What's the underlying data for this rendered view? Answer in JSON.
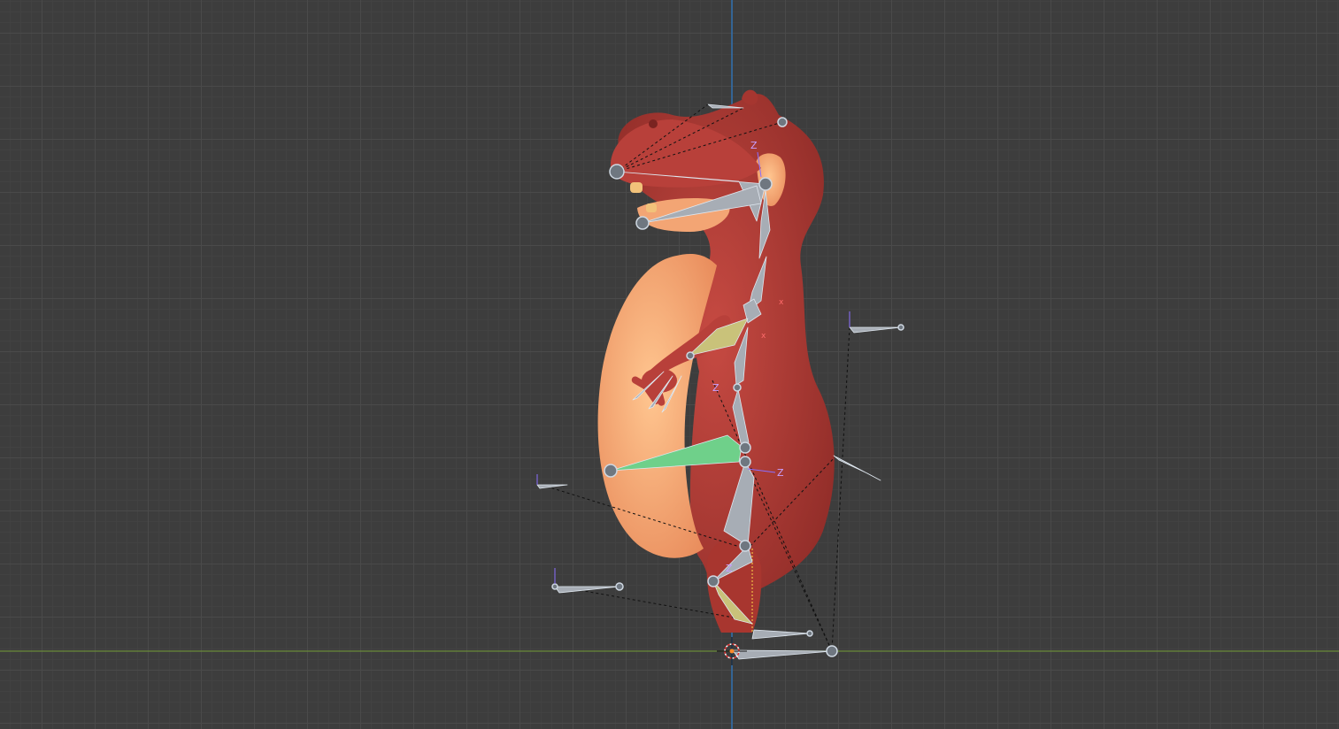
{
  "viewport": {
    "background": "#3d3d3d",
    "grid_color": "#4a4a4a",
    "axis_colors": {
      "vertical": "#2f6fb0",
      "horizontal": "#6a8a3a"
    }
  },
  "character": {
    "body_color": "#b8403a",
    "belly_color": "#f4a870",
    "bone_color": "#a7adb5",
    "selected_bone_color": "#6fd08a",
    "accent_bone_color": "#c9c27a"
  },
  "labels": {
    "axis_z": "Z",
    "axis_x": "x"
  }
}
